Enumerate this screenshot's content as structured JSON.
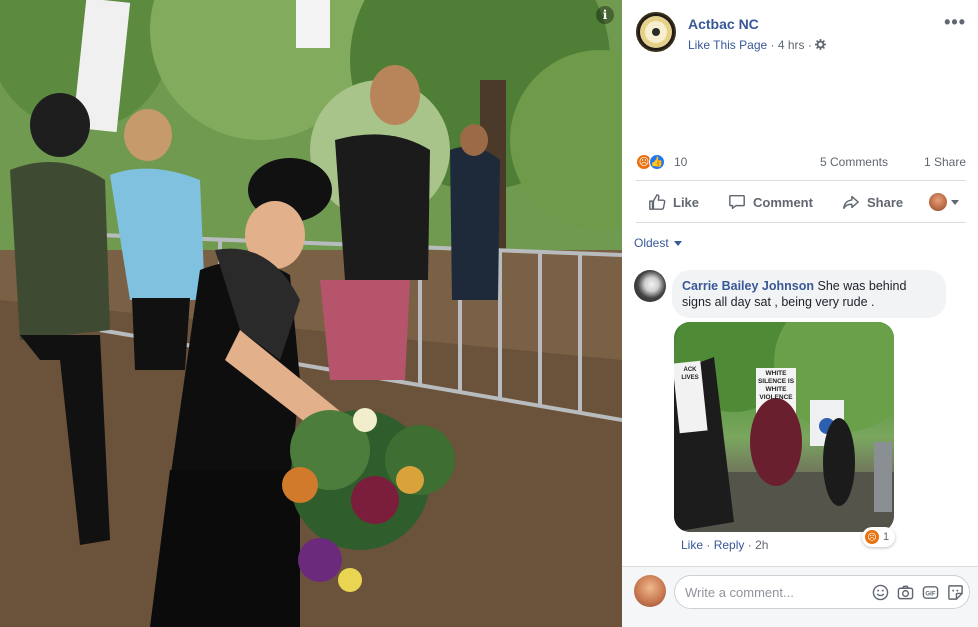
{
  "post": {
    "page_name": "Actbac NC",
    "like_page": "Like This Page",
    "time": "4 hrs",
    "reactions_count": "10",
    "comments_count": "5 Comments",
    "shares_count": "1 Share"
  },
  "actions": {
    "like": "Like",
    "comment": "Comment",
    "share": "Share"
  },
  "sort_label": "Oldest",
  "comment": {
    "author": "Carrie Bailey Johnson",
    "text": "She was behind signs all day sat , being very rude .",
    "like": "Like",
    "reply": "Reply",
    "time": "2h",
    "reaction_count": "1",
    "image_signs": [
      "WHITE SILENCE IS WHITE VIOLENCE",
      "ACK LIVES"
    ]
  },
  "composer": {
    "placeholder": "Write a comment..."
  },
  "icons": {
    "info": "info-icon",
    "more": "more-dots-icon",
    "gear": "gear-icon",
    "angry": "angry-reaction-icon",
    "like_reaction": "like-reaction-icon",
    "emoji": "emoji-icon",
    "camera": "camera-icon",
    "gif": "gif-icon",
    "sticker": "sticker-icon"
  },
  "colors": {
    "link": "#385898",
    "meta": "#606770",
    "angry": "#e9710f",
    "like": "#2078f4"
  }
}
